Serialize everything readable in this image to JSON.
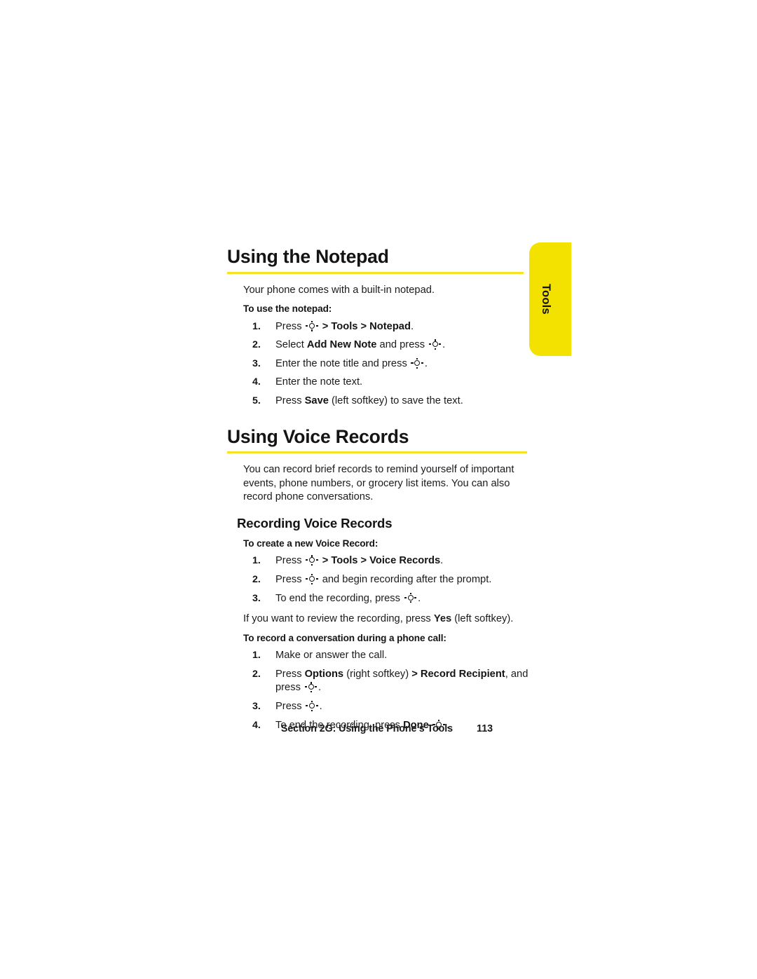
{
  "side_tab": {
    "label": "Tools",
    "color": "#F3E200"
  },
  "accent_rule_color": "#F7E223",
  "sections": [
    {
      "title": "Using the Notepad",
      "intro": "Your phone comes with a built-in notepad.",
      "lead_in": "To use the notepad:",
      "steps": [
        {
          "num": "1.",
          "parts": [
            {
              "t": "text",
              "v": "Press "
            },
            {
              "t": "icon",
              "v": "nav-key-icon"
            },
            {
              "t": "bold",
              "v": " > Tools > Notepad"
            },
            {
              "t": "text",
              "v": "."
            }
          ]
        },
        {
          "num": "2.",
          "parts": [
            {
              "t": "text",
              "v": "Select "
            },
            {
              "t": "bold",
              "v": "Add New Note"
            },
            {
              "t": "text",
              "v": " and press "
            },
            {
              "t": "icon",
              "v": "nav-key-icon"
            },
            {
              "t": "text",
              "v": "."
            }
          ]
        },
        {
          "num": "3.",
          "parts": [
            {
              "t": "text",
              "v": "Enter the note title and press "
            },
            {
              "t": "icon",
              "v": "nav-key-icon"
            },
            {
              "t": "text",
              "v": "."
            }
          ]
        },
        {
          "num": "4.",
          "parts": [
            {
              "t": "text",
              "v": "Enter the note text."
            }
          ]
        },
        {
          "num": "5.",
          "parts": [
            {
              "t": "text",
              "v": "Press "
            },
            {
              "t": "bold",
              "v": "Save"
            },
            {
              "t": "text",
              "v": " (left softkey) to save the text."
            }
          ]
        }
      ]
    },
    {
      "title": "Using Voice Records",
      "intro": "You can record brief records to remind yourself of important events, phone numbers, or grocery list items. You can also record phone conversations.",
      "sub_title": "Recording Voice Records",
      "lead_in": "To create a new Voice Record:",
      "steps": [
        {
          "num": "1.",
          "parts": [
            {
              "t": "text",
              "v": "Press "
            },
            {
              "t": "icon",
              "v": "nav-key-icon"
            },
            {
              "t": "bold",
              "v": " > Tools > Voice Records"
            },
            {
              "t": "text",
              "v": "."
            }
          ]
        },
        {
          "num": "2.",
          "parts": [
            {
              "t": "text",
              "v": "Press "
            },
            {
              "t": "icon",
              "v": "nav-key-icon"
            },
            {
              "t": "text",
              "v": " and begin recording after the prompt."
            }
          ]
        },
        {
          "num": "3.",
          "parts": [
            {
              "t": "text",
              "v": "To end the recording, press "
            },
            {
              "t": "icon",
              "v": "nav-key-icon"
            },
            {
              "t": "text",
              "v": "."
            }
          ]
        }
      ],
      "note_parts": [
        {
          "t": "text",
          "v": "If you want to review the recording, press "
        },
        {
          "t": "bold",
          "v": "Yes"
        },
        {
          "t": "text",
          "v": " (left softkey)."
        }
      ],
      "lead_in_2": "To record a conversation during a phone call:",
      "steps_2": [
        {
          "num": "1.",
          "parts": [
            {
              "t": "text",
              "v": "Make or answer the call."
            }
          ]
        },
        {
          "num": "2.",
          "parts": [
            {
              "t": "text",
              "v": "Press "
            },
            {
              "t": "bold",
              "v": "Options"
            },
            {
              "t": "text",
              "v": " (right softkey) "
            },
            {
              "t": "bold",
              "v": "> Record Recipient"
            },
            {
              "t": "text",
              "v": ", and press "
            },
            {
              "t": "icon",
              "v": "nav-key-icon"
            },
            {
              "t": "text",
              "v": "."
            }
          ]
        },
        {
          "num": "3.",
          "parts": [
            {
              "t": "text",
              "v": "Press "
            },
            {
              "t": "icon",
              "v": "nav-key-icon"
            },
            {
              "t": "text",
              "v": "."
            }
          ]
        },
        {
          "num": "4.",
          "parts": [
            {
              "t": "text",
              "v": "To end the recording, press "
            },
            {
              "t": "bold",
              "v": "Done "
            },
            {
              "t": "icon",
              "v": "nav-key-icon"
            },
            {
              "t": "text",
              "v": "."
            }
          ]
        }
      ]
    }
  ],
  "footer": {
    "section": "Section 2G: Using the Phone’s Tools",
    "page": "113"
  }
}
